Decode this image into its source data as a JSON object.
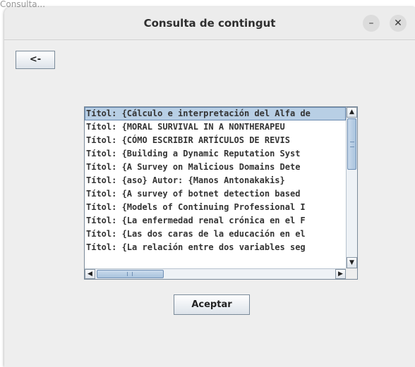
{
  "background_fragment": "Consulta...",
  "window": {
    "title": "Consulta de contingut",
    "minimize_glyph": "–",
    "close_glyph": "✕"
  },
  "back_button": {
    "label": "<-"
  },
  "list": {
    "items": [
      "Títol: {Cálculo e interpretación del Alfa de",
      "Títol: {MORAL SURVIVAL IN A NONTHERAPEU",
      "Títol: {CÓMO ESCRIBIR ARTÍCULOS DE REVIS",
      "Títol: {Building a Dynamic Reputation Syst",
      "Títol: {A Survey on Malicious Domains Dete",
      "Títol: {aso}  Autor: {Manos Antonakakis}",
      "Títol: {A survey of botnet detection based",
      "Títol: {Models of Continuing Professional I",
      "Títol: {La enfermedad renal crónica en el F",
      "Títol: {Las dos caras de la educación en el",
      "Títol: {La relación entre dos variables seg"
    ],
    "selected_index": 0,
    "vscroll_arrows": {
      "up": "▲",
      "down": "▼"
    },
    "hscroll_arrows": {
      "left": "◀",
      "right": "▶"
    }
  },
  "accept_button": {
    "label": "Aceptar"
  }
}
